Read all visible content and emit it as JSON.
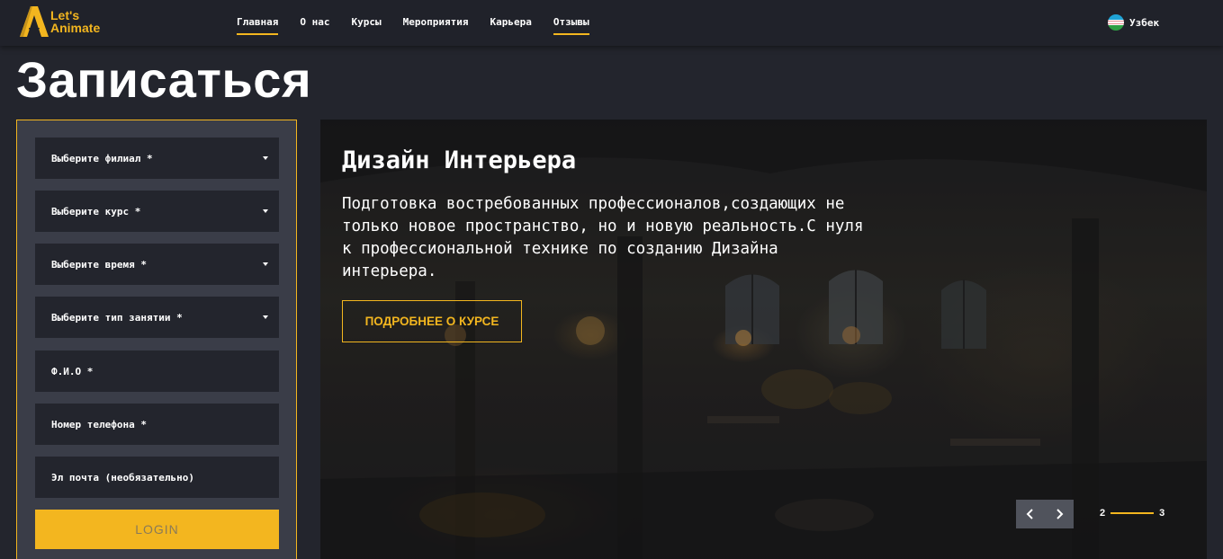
{
  "header": {
    "logo_text": "Let's Animate",
    "nav": [
      {
        "label": "Главная",
        "active": true
      },
      {
        "label": "О нас",
        "active": false
      },
      {
        "label": "Курсы",
        "active": false
      },
      {
        "label": "Мероприятия",
        "active": false
      },
      {
        "label": "Карьера",
        "active": false
      },
      {
        "label": "Отзывы",
        "active": true
      }
    ],
    "language": {
      "label": "Узбек",
      "flag_icon": "uzbekistan-flag-icon"
    }
  },
  "page_title": "Записаться",
  "form": {
    "fields": [
      {
        "label": "Выберите филиал *",
        "type": "select"
      },
      {
        "label": "Выберите курс *",
        "type": "select"
      },
      {
        "label": "Выберите время *",
        "type": "select"
      },
      {
        "label": "Выберите тип занятии *",
        "type": "select"
      },
      {
        "label": "Ф.И.О *",
        "type": "input"
      },
      {
        "label": "Номер телефона *",
        "type": "input"
      },
      {
        "label": "Эл почта (необязательно)",
        "type": "input"
      }
    ],
    "submit_label": "LOGIN"
  },
  "hero": {
    "title": "Дизайн Интерьера",
    "description": "Подготовка востребованных профессионалов,создающих не только новое пространство, но и новую реальность.С нуля к профессиональной технике по созданию Дизайна интерьера.",
    "button_label": "ПОДРОБНЕЕ О КУРСЕ",
    "pager": {
      "current": "2",
      "total": "3"
    },
    "prev_icon": "chevron-left-icon",
    "next_icon": "chevron-right-icon"
  },
  "colors": {
    "accent": "#f3b61f",
    "background": "#23252d",
    "form_panel": "#3a3d48"
  }
}
